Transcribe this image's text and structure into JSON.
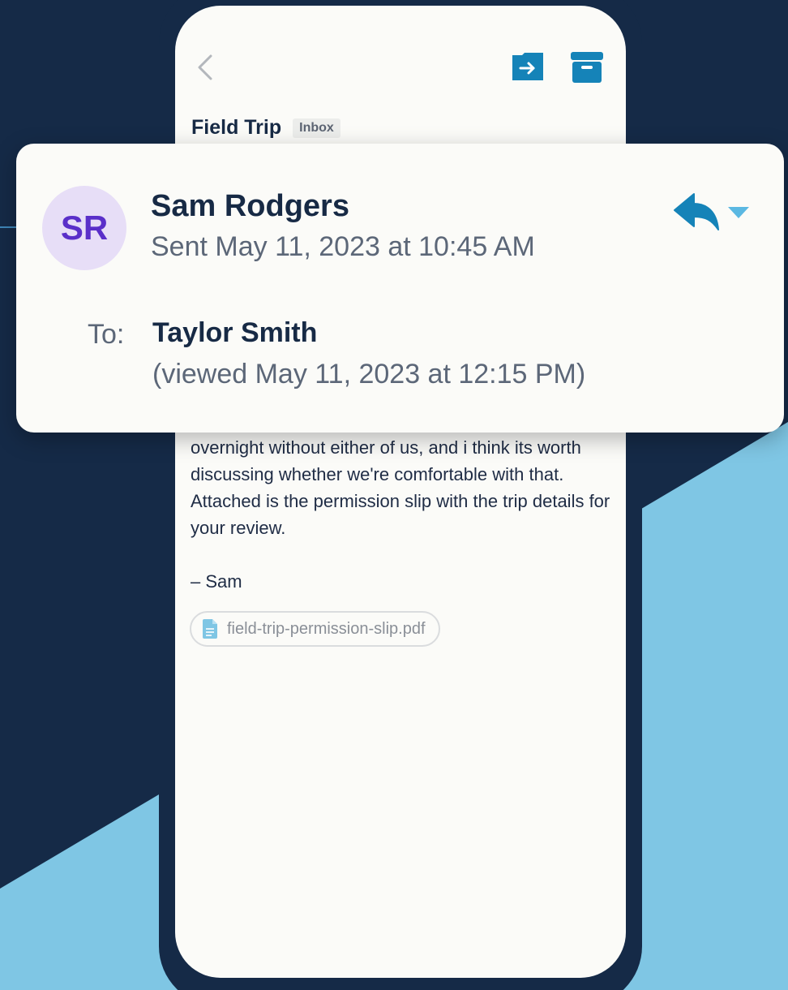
{
  "email": {
    "subject": "Field Trip",
    "folder": "Inbox",
    "body": "overnight without either of us, and i think its worth discussing whether we're comfortable with that. Attached is the permission slip with the trip details for your review.",
    "signature": "– Sam",
    "attachment": {
      "file_name": "field-trip-permission-slip.pdf",
      "icon": "document-icon"
    }
  },
  "details_card": {
    "avatar_initials": "SR",
    "sender_name": "Sam Rodgers",
    "sent": "Sent May 11, 2023 at 10:45 AM",
    "to_label": "To:",
    "recipient_name": "Taylor Smith",
    "viewed": "(viewed May 11, 2023 at 12:15 PM)"
  },
  "toolbar": {
    "back_icon": "chevron-left-icon",
    "move_icon": "move-to-folder-icon",
    "archive_icon": "archive-icon",
    "reply_icon": "reply-icon",
    "reply_menu_icon": "caret-down-icon"
  },
  "colors": {
    "background_navy": "#152a47",
    "background_light_blue": "#7fc6e4",
    "accent_blue": "#1583b8",
    "avatar_bg": "#e7def7",
    "avatar_text": "#5a2fc9"
  }
}
